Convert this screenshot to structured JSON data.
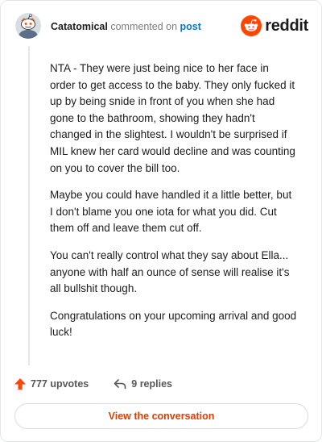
{
  "header": {
    "author": "Catatomical",
    "action_text": "commented on",
    "post_link": "post",
    "brand_word": "reddit"
  },
  "comment": {
    "paragraphs": [
      "NTA - They were just being nice to her face in order to get access to the baby. They only fucked it up by being snide in front of you when she had gone to the bathroom, showing they hadn't changed in the slightest. I wouldn't be surprised if MIL knew her card would decline and was counting on you to cover the bill too.",
      "Maybe you could have handled it a little better, but I don't blame you one iota for what you did. Cut them off and leave them cut off.",
      "You can't really control what they say about Ella... anyone with half an ounce of sense will realise it's all bullshit though.",
      "Congratulations on your upcoming arrival and good luck!"
    ]
  },
  "actions": {
    "upvotes_label": "777 upvotes",
    "replies_label": "9 replies"
  },
  "cta": {
    "label": "View the conversation"
  },
  "colors": {
    "brand": "#ff4500",
    "link": "#0079d3",
    "cta_text": "#e03d00",
    "text": "#1c1c1c",
    "muted": "#7c7c7c"
  },
  "icons": {
    "avatar": "snoo-avatar",
    "brand": "reddit-logo-icon",
    "upvote": "upvote-arrow-icon",
    "reply": "reply-arrow-icon"
  }
}
